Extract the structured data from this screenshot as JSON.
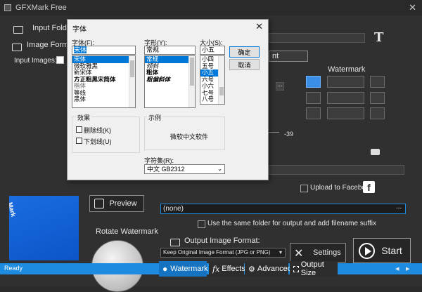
{
  "window": {
    "title": "GFXMark Free",
    "close_glyph": "✕"
  },
  "main": {
    "input_folder_label": "Input Folder",
    "image_formats_label": "Image Formats",
    "input_images_label": "Input Images:",
    "watermark_section_label": "Watermark",
    "slider_value": "-39",
    "ellipsis": "...",
    "text_tool_glyph": "T",
    "partial_button_text": "nt",
    "upload_facebook_label": "Upload to Facebook",
    "preview_button": "Preview",
    "preview_stamp_text": "Mark",
    "output_path_value": "(none)",
    "same_folder_label": "Use the same folder for output and add filename suffix",
    "rotate_watermark_label": "Rotate Watermark",
    "output_format_label": "Output Image Format:",
    "output_format_value": "Keep Original Image Format (JPG or PNG)",
    "settings_button": "Settings",
    "start_button": "Start"
  },
  "status": {
    "text": "Ready"
  },
  "nav": {
    "tabs": [
      {
        "label": "Watermark",
        "active": true
      },
      {
        "label": "Effects",
        "active": false
      },
      {
        "label": "Advanced",
        "active": false
      },
      {
        "label": "Output Size",
        "active": false
      }
    ],
    "prev_glyph": "◂",
    "next_glyph": "▸"
  },
  "font_dialog": {
    "title": "字体",
    "close_glyph": "✕",
    "font_label": "字体(F):",
    "style_label": "字形(Y):",
    "size_label": "大小(S):",
    "font_value": "宋体",
    "style_value": "常规",
    "size_value": "小五",
    "fonts": [
      "宋体",
      "微软雅黑",
      "新宋体",
      "方正粗黑宋简体",
      "楷体",
      "等线",
      "黑体"
    ],
    "styles": [
      "常规",
      "倾斜",
      "粗体",
      "粗偏斜体"
    ],
    "sizes": [
      "小四",
      "五号",
      "小五",
      "六号",
      "小六",
      "七号",
      "八号"
    ],
    "ok_button": "确定",
    "cancel_button": "取消",
    "effects_label": "效果",
    "strikeout_label": "删除线(K)",
    "underline_label": "下划线(U)",
    "sample_label": "示例",
    "sample_text": "微软中文软件",
    "charset_label": "字符集(R):",
    "charset_value": "中文 GB2312"
  },
  "colors": {
    "accent": "#1d8be0",
    "active_tab": "#1573c2",
    "selected_tile": "#3a8ee6"
  }
}
